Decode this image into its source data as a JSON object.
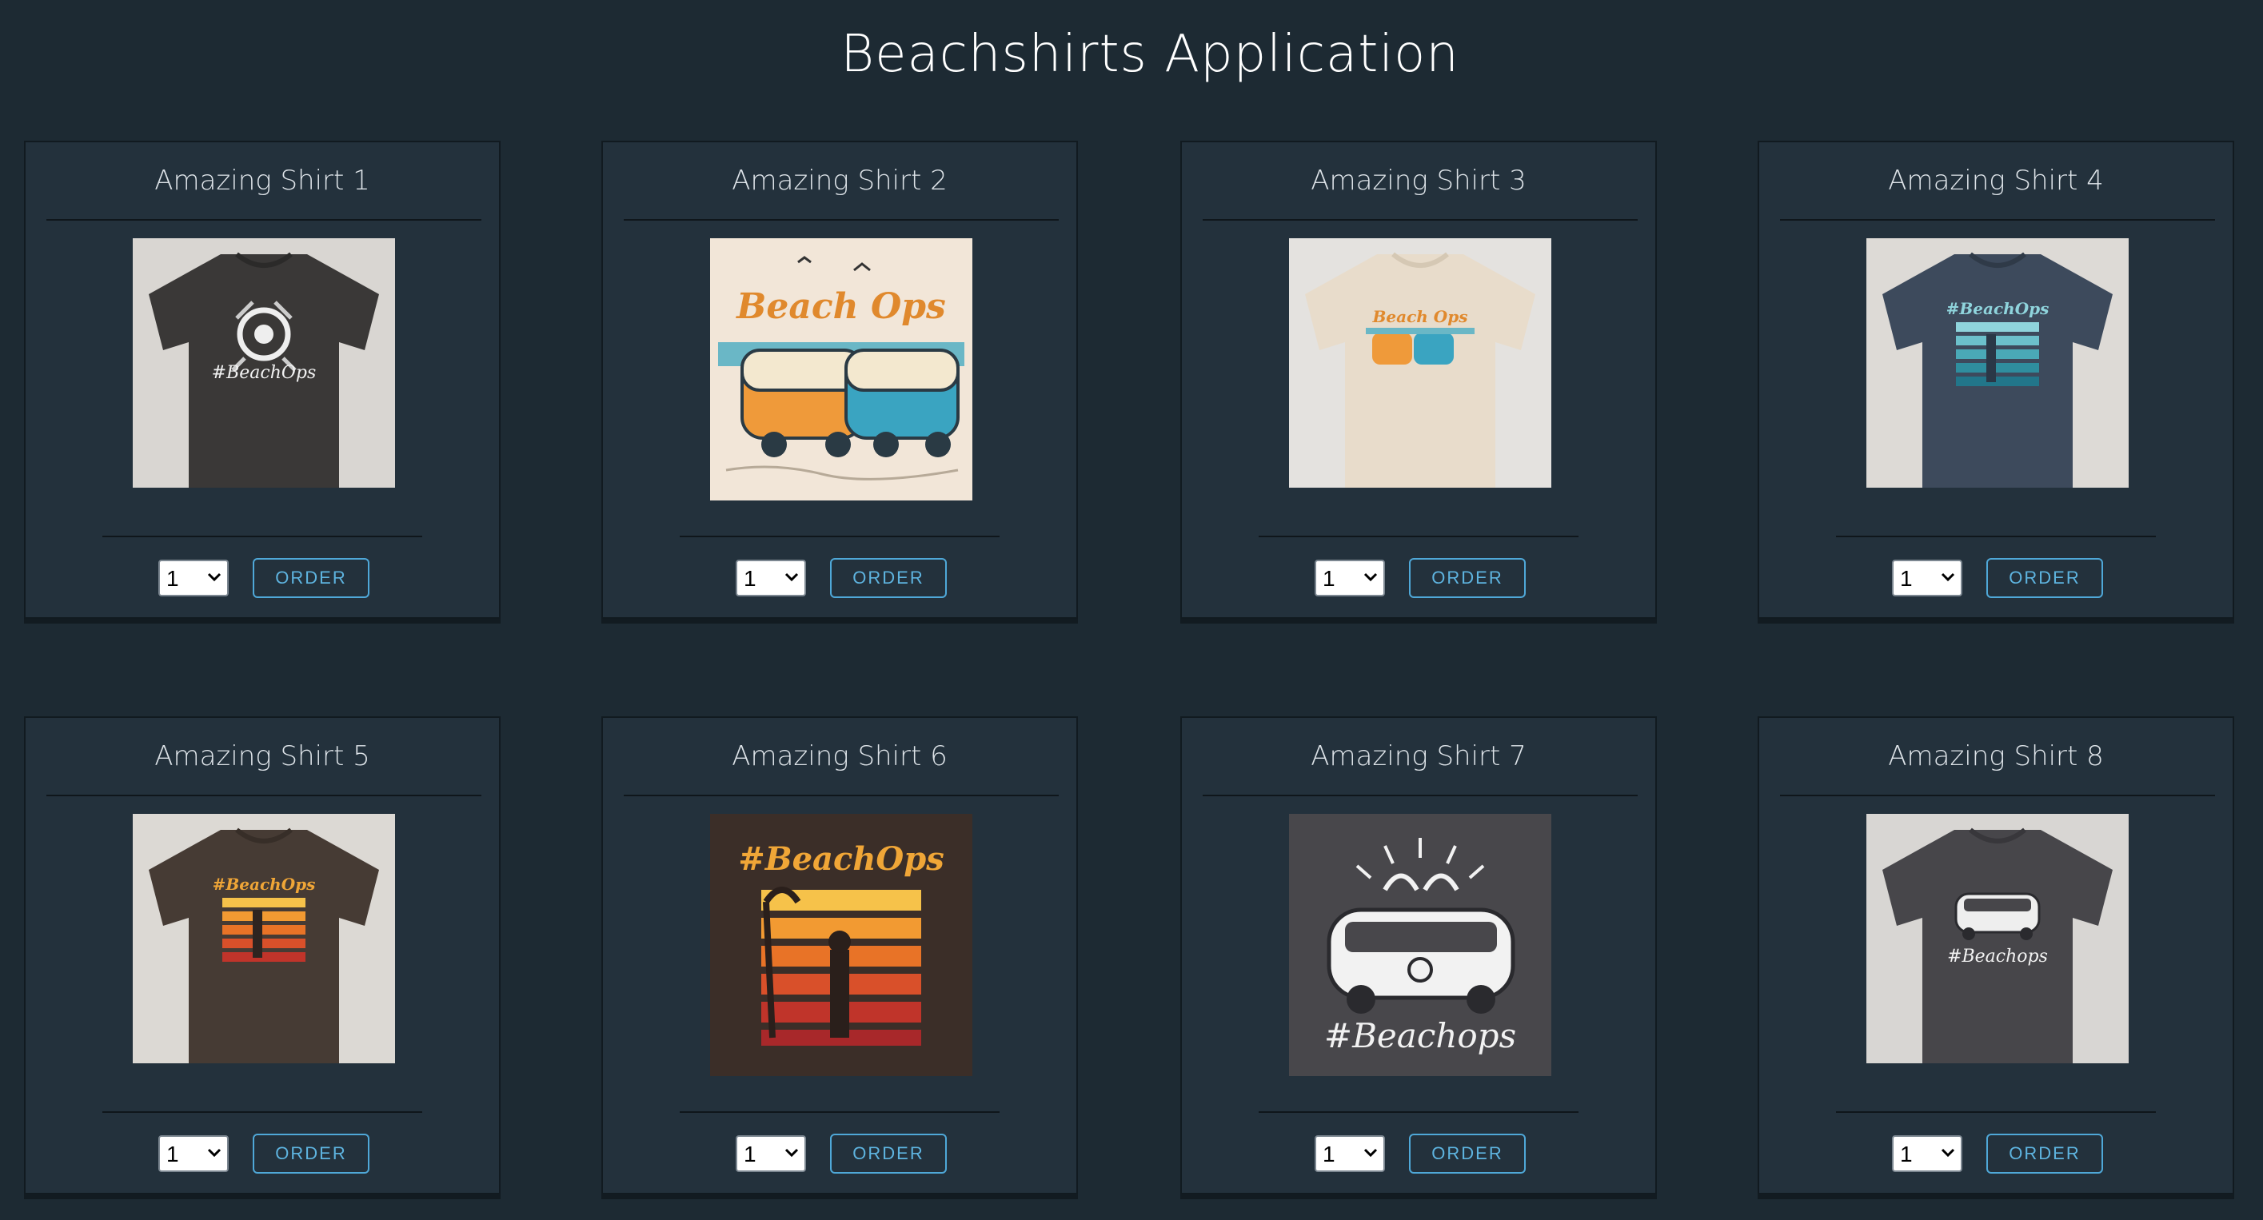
{
  "page": {
    "title": "Beachshirts Application"
  },
  "shirts": [
    {
      "name": "Amazing Shirt 1",
      "quantity": "1",
      "order_label": "ORDER",
      "design": "#BeachOps palm logo on charcoal shirt"
    },
    {
      "name": "Amazing Shirt 2",
      "quantity": "1",
      "order_label": "ORDER",
      "design": "Beach Ops vans artwork"
    },
    {
      "name": "Amazing Shirt 3",
      "quantity": "1",
      "order_label": "ORDER",
      "design": "Beach Ops vans on oatmeal shirt"
    },
    {
      "name": "Amazing Shirt 4",
      "quantity": "1",
      "order_label": "ORDER",
      "design": "#BeachOps teal sunset on navy shirt"
    },
    {
      "name": "Amazing Shirt 5",
      "quantity": "1",
      "order_label": "ORDER",
      "design": "#BeachOps orange sunset on brown shirt"
    },
    {
      "name": "Amazing Shirt 6",
      "quantity": "1",
      "order_label": "ORDER",
      "design": "#BeachOps orange sunset artwork"
    },
    {
      "name": "Amazing Shirt 7",
      "quantity": "1",
      "order_label": "ORDER",
      "design": "#Beachops van artwork"
    },
    {
      "name": "Amazing Shirt 8",
      "quantity": "1",
      "order_label": "ORDER",
      "design": "#Beachops van on charcoal shirt"
    }
  ],
  "colors": {
    "background": "#1d2a33",
    "card": "#23313c",
    "accent": "#4fa8d8"
  }
}
